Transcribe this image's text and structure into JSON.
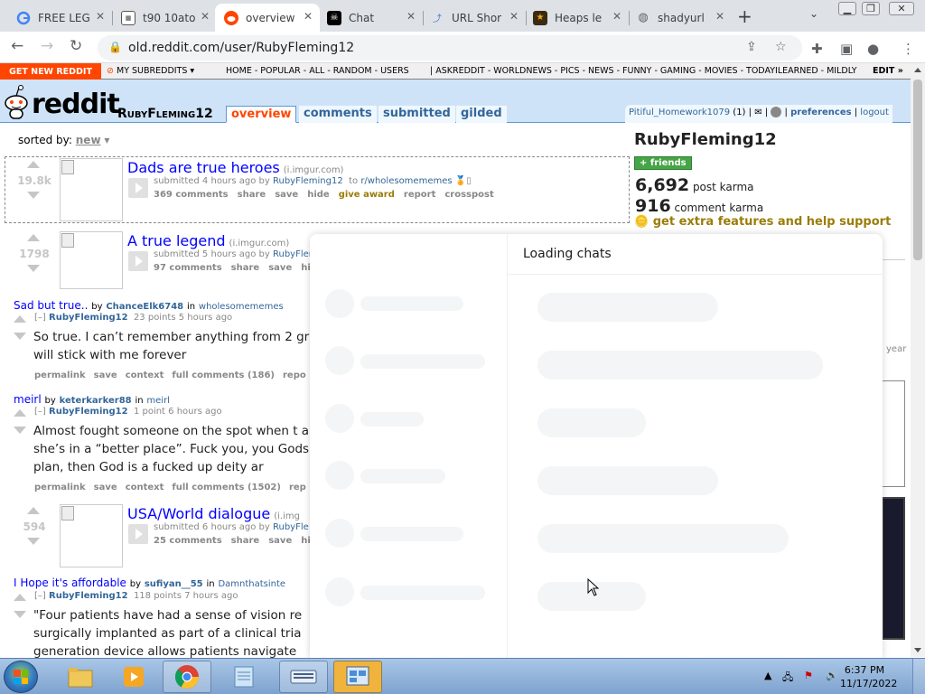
{
  "browser": {
    "tabs": [
      {
        "title": "FREE LEG",
        "icon": "google-icon"
      },
      {
        "title": "t90 10ato",
        "icon": "table-icon"
      },
      {
        "title": "overview",
        "icon": "reddit-icon",
        "active": true
      },
      {
        "title": "Chat",
        "icon": "pirate-icon"
      },
      {
        "title": "URL Shor",
        "icon": "link-icon"
      },
      {
        "title": "Heaps le",
        "icon": "star-icon"
      },
      {
        "title": "shadyurl",
        "icon": "globe-icon"
      }
    ],
    "url": "old.reddit.com/user/RubyFleming12"
  },
  "srbar": {
    "get_new": "GET NEW REDDIT",
    "my_subreddits": "MY SUBREDDITS",
    "links1": "HOME - POPULAR - ALL - RANDOM - USERS",
    "links2": "|   ASKREDDIT - WORLDNEWS - PICS - NEWS - FUNNY - GAMING - MOVIES - TODAYILEARNED - MILDLY",
    "edit": "EDIT »"
  },
  "header": {
    "wordmark": "reddit",
    "page_name": "RubyFleming12",
    "tabs": [
      "overview",
      "comments",
      "submitted",
      "gilded"
    ],
    "user": "Pitiful_Homework1079",
    "user_karma": "(1)",
    "preferences": "preferences",
    "logout": "logout"
  },
  "listing": {
    "sorted_label": "sorted by:",
    "sorted_value": "new",
    "posts": [
      {
        "score": "19.8k",
        "title": "Dads are true heroes",
        "domain": "(i.imgur.com)",
        "tagline_pre": "submitted 4 hours ago by",
        "author": "RubyFleming12",
        "tagline_to": "to",
        "subreddit": "r/wholesomememes",
        "comments": "369 comments",
        "share": "share",
        "save": "save",
        "hide": "hide",
        "award": "give award",
        "report": "report",
        "crosspost": "crosspost"
      },
      {
        "score": "1798",
        "title": "A true legend",
        "domain": "(i.imgur.com)",
        "tagline_pre": "submitted 5 hours ago by",
        "author": "RubyFleming12",
        "comments": "97 comments",
        "share": "share",
        "save": "save",
        "hide": "hi"
      },
      {
        "score": "594",
        "title": "USA/World dialogue",
        "domain": "(i.img",
        "tagline_pre": "submitted 6 hours ago by",
        "author": "RubyFle",
        "comments": "25 comments",
        "share": "share",
        "save": "save",
        "hide": "hi"
      }
    ],
    "comments": [
      {
        "link_title": "Sad but true..",
        "by": "by",
        "link_author": "ChanceElk6748",
        "in": "in",
        "subreddit": "wholesomememes",
        "collapse": "[–]",
        "author": "RubyFleming12",
        "meta": "23 points 5 hours ago",
        "body": "So true. I can’t remember anything from 2 grade will stick with me forever",
        "permalink": "permalink",
        "save": "save",
        "context": "context",
        "full": "full comments (186)",
        "report": "repo"
      },
      {
        "link_title": "meirl",
        "by": "by",
        "link_author": "keterkarker88",
        "in": "in",
        "subreddit": "meirl",
        "collapse": "[–]",
        "author": "RubyFleming12",
        "meta": "1 point 6 hours ago",
        "body": "Almost fought someone on the spot when t and she’s in a “better place”. Fuck you, you Gods plan, then God is a fucked up deity ar",
        "permalink": "permalink",
        "save": "save",
        "context": "context",
        "full": "full comments (1502)",
        "report": "rep"
      },
      {
        "link_title": "I Hope it's affordable",
        "by": "by",
        "link_author": "sufiyan__55",
        "in": "in",
        "subreddit": "Damnthatsinte",
        "collapse": "[–]",
        "author": "RubyFleming12",
        "meta": "118 points 7 hours ago",
        "body": "\"Four patients have had a sense of vision re surgically implanted as part of a clinical tria generation device allows patients navigate"
      }
    ]
  },
  "sidebar": {
    "name": "RubyFleming12",
    "friends": "+ friends",
    "post_karma": "6,692",
    "post_karma_label": "post karma",
    "comment_karma": "916",
    "comment_karma_label": "comment karma",
    "gold_promo": "get extra features and help support",
    "year": "year"
  },
  "chat": {
    "title": "Loading chats"
  },
  "taskbar": {
    "time": "6:37 PM",
    "date": "11/17/2022"
  }
}
